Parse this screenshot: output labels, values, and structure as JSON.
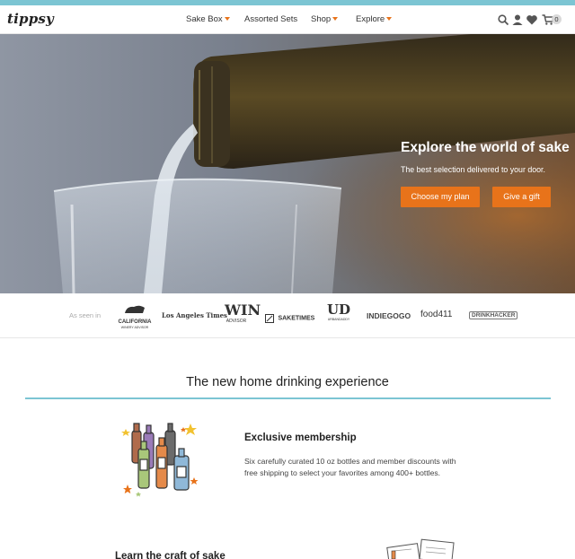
{
  "brand": {
    "logo_text": "tippsy",
    "accent": "#e8731a",
    "teal": "#7cc5d3"
  },
  "nav": {
    "items": [
      {
        "label": "Sake Box",
        "has_caret": true
      },
      {
        "label": "Assorted Sets",
        "has_caret": false
      },
      {
        "label": "Shop",
        "has_caret": true
      },
      {
        "label": "Explore",
        "has_caret": true
      }
    ],
    "icons": [
      "search-icon",
      "account-icon",
      "heart-icon",
      "cart-icon"
    ],
    "cart_count": "0"
  },
  "hero": {
    "title": "Explore the world of sake",
    "subtitle": "The best selection delivered to your door.",
    "primary_button": "Choose my plan",
    "secondary_button": "Give a gift"
  },
  "press": {
    "label": "As seen in",
    "logos": [
      {
        "name": "CALIFORNIA",
        "sub": "WINERY ADVISOR"
      },
      {
        "name": "Los Angeles Times"
      },
      {
        "name": "WIN",
        "sub": "ADVISOR"
      },
      {
        "name": "SAKETIMES"
      },
      {
        "name": "UD",
        "sub": "URBANDADDY"
      },
      {
        "name": "INDIEGOGO"
      },
      {
        "name": "food411"
      },
      {
        "name": "DRINKHACKER"
      }
    ]
  },
  "section": {
    "title": "The new home drinking experience"
  },
  "features": [
    {
      "title": "Exclusive membership",
      "body": "Six carefully curated 10 oz bottles and member discounts with free shipping to select your favorites among 400+ bottles."
    },
    {
      "title": "Learn the craft of sake"
    }
  ]
}
